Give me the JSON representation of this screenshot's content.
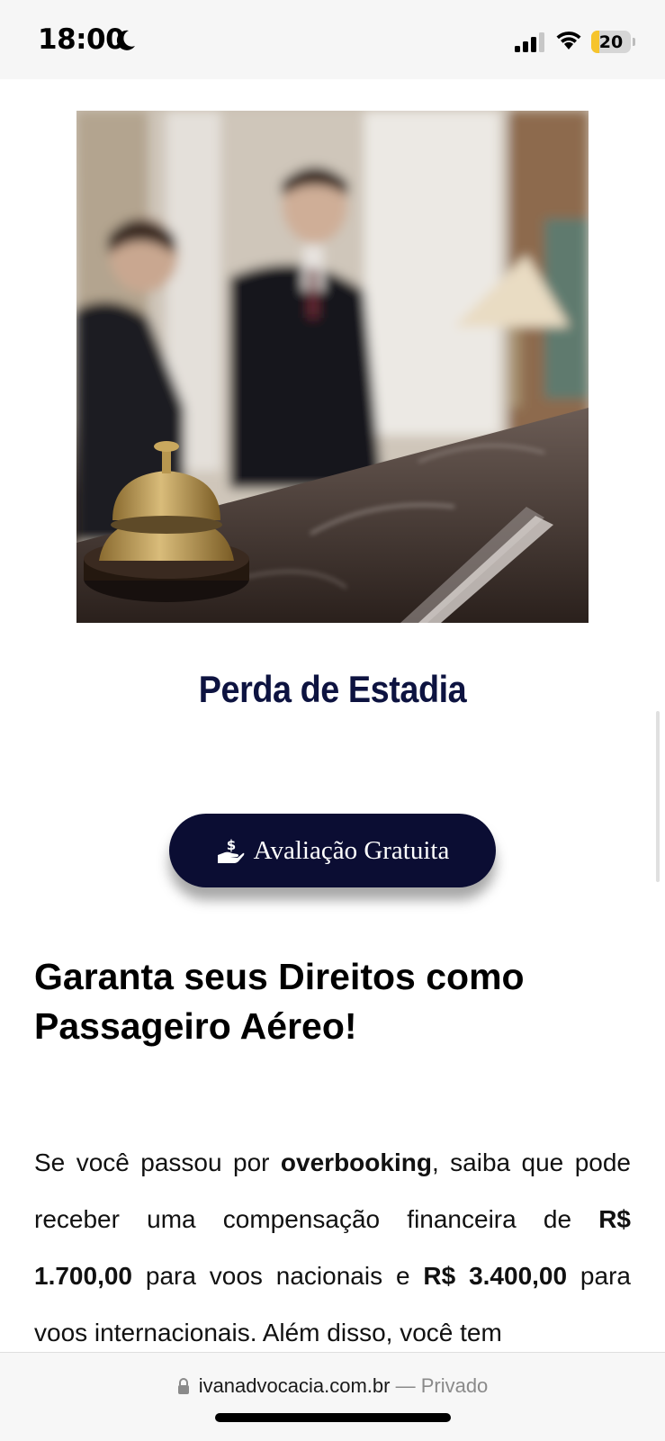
{
  "status_bar": {
    "time": "18:00",
    "battery": "20",
    "battery_fraction": 0.2,
    "icons": [
      "moon-icon",
      "cellular-signal-icon",
      "wifi-icon",
      "battery-icon"
    ]
  },
  "hero_image": {
    "description_icon": "hotel-reception-photo"
  },
  "section": {
    "title": "Perda de Estadia"
  },
  "cta": {
    "label": "Avaliação Gratuita",
    "icon": "hand-money-icon",
    "color": "#0b0d33"
  },
  "headline": {
    "line1": "Garanta seus Direitos como",
    "line2": "Passageiro Aéreo!"
  },
  "body": {
    "p1": "Se você passou por ",
    "b1": "overbooking",
    "p2": ", saiba que pode receber uma compensação financeira de ",
    "b2": "R$ 1.700,00",
    "p3": " para voos nacionais e ",
    "b3": "R$ 3.400,00",
    "p4": " para voos internacionais. Além disso, você tem"
  },
  "browser": {
    "domain": "ivanadvocacia.com.br",
    "separator": " — ",
    "mode": "Privado"
  },
  "colors": {
    "title": "#0d1340",
    "button": "#0b0d33",
    "battery": "#f6c42c"
  }
}
